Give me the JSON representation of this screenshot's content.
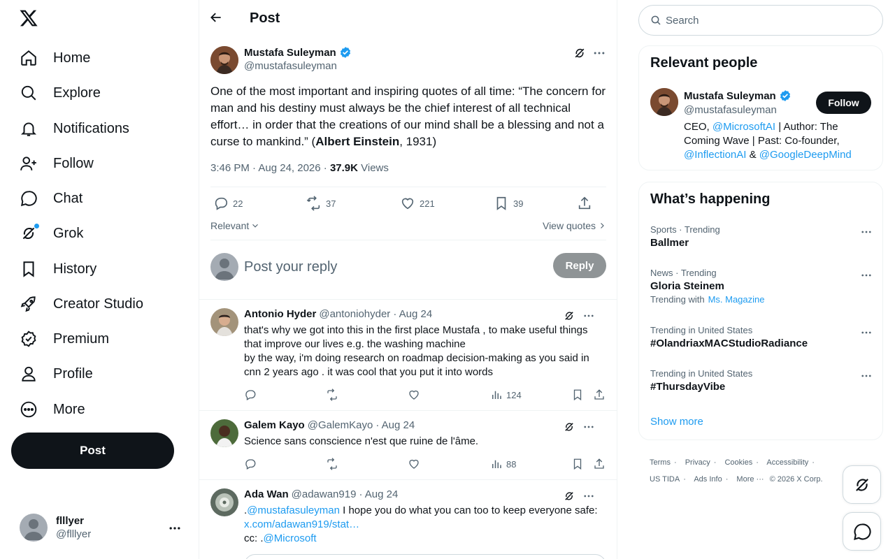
{
  "nav": {
    "logo": "x-logo",
    "items": [
      {
        "label": "Home",
        "icon": "home-icon"
      },
      {
        "label": "Explore",
        "icon": "search-icon"
      },
      {
        "label": "Notifications",
        "icon": "bell-icon"
      },
      {
        "label": "Follow",
        "icon": "person-plus-icon"
      },
      {
        "label": "Chat",
        "icon": "chat-bubble-icon"
      },
      {
        "label": "Grok",
        "icon": "grok-icon"
      },
      {
        "label": "History",
        "icon": "bookmark-icon"
      },
      {
        "label": "Creator Studio",
        "icon": "rocket-icon"
      },
      {
        "label": "Premium",
        "icon": "verified-badge-icon"
      },
      {
        "label": "Profile",
        "icon": "person-icon"
      },
      {
        "label": "More",
        "icon": "more-circle-icon"
      }
    ],
    "post_button": "Post",
    "account": {
      "name": "flllyer",
      "handle": "@flllyer"
    }
  },
  "header": {
    "title": "Post"
  },
  "tweet": {
    "author": "Mustafa Suleyman",
    "handle": "@mustafasuleyman",
    "text_before": "One of the most important and inspiring quotes of all time: “The concern for man and his destiny must always be the chief interest of all technical effort… in order that the creations of our mind shall be a blessing and not a curse to mankind.” (",
    "text_bold": "Albert Einstein",
    "text_after": ", 1931)",
    "time": "3:46 PM · Aug 24, 2026 · ",
    "views_count": "37.9K",
    "views_label": " Views",
    "replies": "22",
    "reposts": "37",
    "likes": "221",
    "bookmarks": "39"
  },
  "sort": {
    "relevant": "Relevant",
    "view_quotes": "View quotes"
  },
  "reply_box": {
    "placeholder": "Post your reply",
    "button": "Reply"
  },
  "replies": [
    {
      "name": "Antonio Hyder",
      "handle": "@antoniohyder",
      "date": "· Aug 24",
      "line1": "that's why we got into this in the first place Mustafa , to make useful things that improve our lives e.g. the washing machine",
      "line2": "by the way, i'm doing research on roadmap decision-making as you said in cnn 2 years ago . it was cool that you put it into words",
      "views": "124"
    },
    {
      "name": "Galem Kayo",
      "handle": "@GalemKayo",
      "date": "· Aug 24",
      "line1": "Science sans conscience n'est que ruine de l'âme.",
      "views": "88"
    },
    {
      "name": "Ada Wan",
      "handle": "@adawan919",
      "date": "· Aug 24",
      "prefix": ".",
      "mention": "@mustafasuleyman",
      "text": " I hope you do what you can too to keep everyone safe:",
      "link": "x.com/adawan919/stat…",
      "cc": "cc: .",
      "cc_mention": "@Microsoft"
    }
  ],
  "search": {
    "placeholder": "Search"
  },
  "relevant_people": {
    "title": "Relevant people",
    "name": "Mustafa Suleyman",
    "handle": "@mustafasuleyman",
    "follow": "Follow",
    "bio_1": "CEO, ",
    "bio_m1": "@MicrosoftAI",
    "bio_2": " | Author: The Coming Wave | Past: Co-founder, ",
    "bio_m2": "@InflectionAI",
    "bio_3": " & ",
    "bio_m3": "@GoogleDeepMind"
  },
  "happening": {
    "title": "What’s happening",
    "trends": [
      {
        "category": "Sports · Trending",
        "title": "Ballmer"
      },
      {
        "category": "News · Trending",
        "title": "Gloria Steinem",
        "with_label": "Trending with",
        "with_link": "Ms. Magazine"
      },
      {
        "category": "Trending in United States",
        "title": "#OlandriaxMACStudioRadiance"
      },
      {
        "category": "Trending in United States",
        "title": "#ThursdayVibe"
      }
    ],
    "show_more": "Show more"
  },
  "footer": {
    "terms": "Terms",
    "privacy": "Privacy",
    "cookies": "Cookies",
    "accessibility": "Accessibility",
    "ads": "US TIDA",
    "ads_info": "Ads Info",
    "more": "More ···",
    "copyright": "© 2026 X Corp."
  },
  "colors": {
    "accent": "#1d9bf0",
    "text": "#0f1419",
    "muted": "#536471",
    "border": "#eff3f4"
  }
}
